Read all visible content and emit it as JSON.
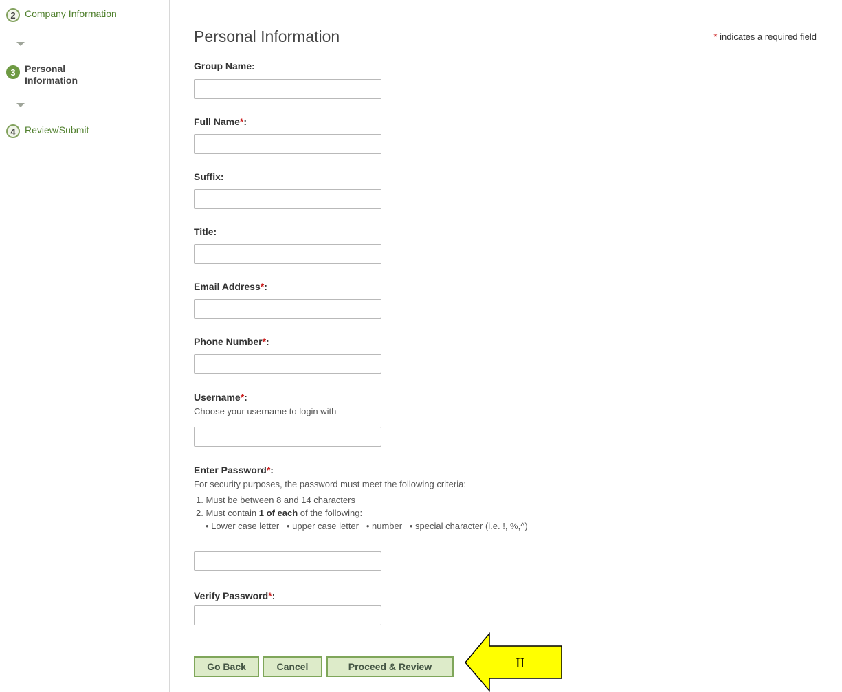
{
  "steps": [
    {
      "number": "2",
      "label": "Company Information",
      "state": "complete"
    },
    {
      "number": "3",
      "label_line1": "Personal",
      "label_line2": "Information",
      "state": "active"
    },
    {
      "number": "4",
      "label": "Review/Submit",
      "state": "upcoming"
    }
  ],
  "header": {
    "title": "Personal Information",
    "required_star": "*",
    "required_note": " indicates a required field"
  },
  "fields": {
    "group_name": {
      "label": "Group Name:",
      "value": ""
    },
    "full_name": {
      "label": "Full Name",
      "star": "*",
      "colon": ":",
      "value": ""
    },
    "suffix": {
      "label": "Suffix:",
      "value": ""
    },
    "title": {
      "label": "Title:",
      "value": ""
    },
    "email": {
      "label": "Email Address",
      "star": "*",
      "colon": ":",
      "value": ""
    },
    "phone": {
      "label": "Phone Number",
      "star": "*",
      "colon": ":",
      "value": ""
    },
    "username": {
      "label": "Username",
      "star": "*",
      "colon": ":",
      "help": "Choose your username to login with",
      "value": ""
    },
    "password": {
      "label": "Enter Password",
      "star": "*",
      "colon": ":",
      "help": "For security purposes, the password must meet the following criteria:",
      "criteria_1": "1.  Must be between 8 and 14 characters",
      "criteria_2_pre": "2.  Must contain ",
      "criteria_2_bold": "1 of each",
      "criteria_2_post": " of the following:",
      "bullets": "• Lower case letter   • upper case letter   • number   • special character (i.e. !, %,^)",
      "value": ""
    },
    "verify_password": {
      "label": "Verify Password",
      "star": "*",
      "colon": ":",
      "value": ""
    }
  },
  "buttons": {
    "go_back": "Go Back",
    "cancel": "Cancel",
    "proceed": "Proceed & Review"
  },
  "annotation": {
    "text": "II",
    "color": "#ffff00"
  },
  "colors": {
    "accent_green": "#6e9a43",
    "button_bg": "#ddebc9",
    "required_red": "#cc2222"
  }
}
